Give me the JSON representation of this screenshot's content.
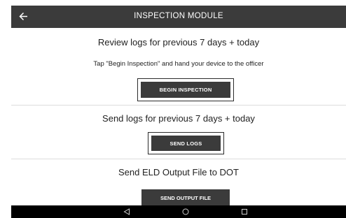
{
  "header": {
    "title": "INSPECTION MODULE",
    "back_icon": "arrow-left-icon"
  },
  "review": {
    "heading": "Review logs for previous 7 days + today",
    "instruction": "Tap \"Begin Inspection\" and hand your device to the officer",
    "button_label": "BEGIN INSPECTION"
  },
  "send": {
    "heading": "Send logs for previous 7 days + today",
    "button_label": "SEND LOGS"
  },
  "output": {
    "heading": "Send ELD Output File to DOT",
    "button_label": "SEND OUTPUT FILE"
  },
  "navbar": {
    "icons": [
      "nav-back-icon",
      "nav-home-icon",
      "nav-recents-icon"
    ]
  },
  "colors": {
    "header_bg": "#3b3b3b",
    "button_bg": "#3b3b3b",
    "navbar_bg": "#000000",
    "text": "#222222"
  }
}
